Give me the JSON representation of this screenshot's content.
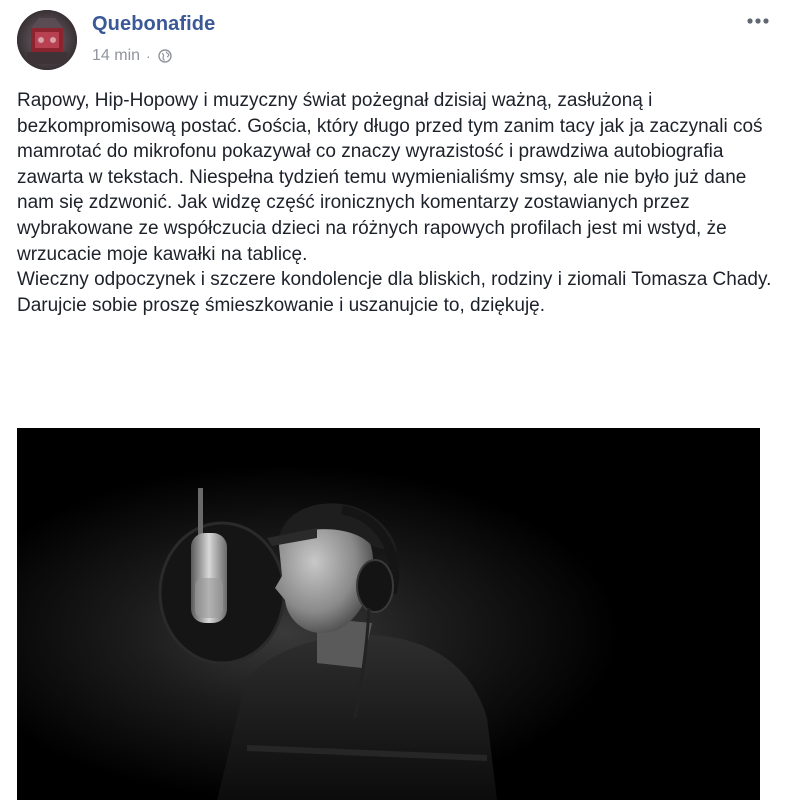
{
  "post": {
    "author": "Quebonafide",
    "time": "14 min",
    "separator": "·",
    "privacy_icon": "globe-icon",
    "more_icon": "more-options-icon",
    "paragraphs": [
      "Rapowy, Hip-Hopowy i muzyczny świat pożegnał dzisiaj ważną, zasłużoną i bezkompromisową postać. Gościa, który długo przed tym zanim tacy jak ja zaczynali coś mamrotać do mikrofonu pokazywał co znaczy wyrazistość i prawdziwa autobiografia zawarta w tekstach. Niespełna tydzień temu wymienialiśmy smsy, ale nie było już dane nam się zdzwonić. Jak widzę część ironicznych komentarzy zostawianych przez wybrakowane ze współczucia dzieci na różnych rapowych profilach jest mi wstyd, że wrzucacie moje kawałki na tablicę.",
      "Wieczny odpoczynek i szczere kondolencje dla bliskich, rodziny i ziomali Tomasza Chady.",
      "Darujcie sobie proszę śmieszkowanie i uszanujcie to, dziękuję."
    ]
  },
  "colors": {
    "author_link": "#3b5998",
    "meta_text": "#90949c",
    "body_text": "#1d2129",
    "photo_background": "#000000"
  }
}
